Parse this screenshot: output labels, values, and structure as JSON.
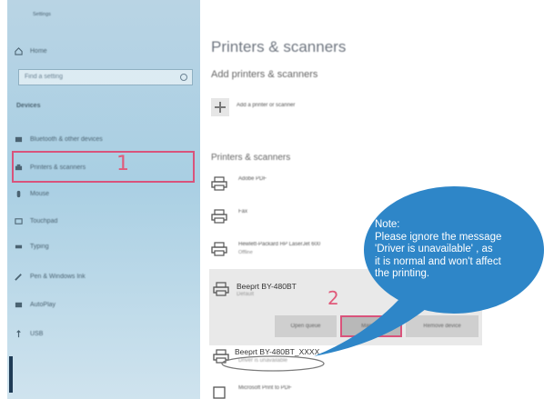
{
  "sidebar": {
    "title": "Settings",
    "home": "Home",
    "search_placeholder": "Find a setting",
    "section": "Devices",
    "items": [
      {
        "label": "Bluetooth & other devices",
        "icon": "bluetooth-icon"
      },
      {
        "label": "Printers & scanners",
        "icon": "printer-icon"
      },
      {
        "label": "Mouse",
        "icon": "mouse-icon"
      },
      {
        "label": "Touchpad",
        "icon": "touchpad-icon"
      },
      {
        "label": "Typing",
        "icon": "keyboard-icon"
      },
      {
        "label": "Pen & Windows Ink",
        "icon": "pen-icon"
      },
      {
        "label": "AutoPlay",
        "icon": "autoplay-icon"
      },
      {
        "label": "USB",
        "icon": "usb-icon"
      }
    ],
    "marker": "1"
  },
  "main": {
    "title": "Printers & scanners",
    "add_section": "Add printers & scanners",
    "add_label": "Add a printer or scanner",
    "list_section": "Printers & scanners",
    "printers": [
      {
        "name": "Adobe PDF",
        "sub": ""
      },
      {
        "name": "Fax",
        "sub": ""
      },
      {
        "name": "Hewlett-Packard HP LaserJet 600",
        "sub": "Offline"
      }
    ],
    "selected": {
      "name": "Beeprt BY-480BT",
      "sub": "Default",
      "buttons": [
        "Open queue",
        "Manage",
        "Remove device"
      ],
      "marker": "2"
    },
    "bottom_printer": {
      "name": "Beeprt BY-480BT_XXXX",
      "sub": "Driver is unavailable"
    },
    "last_printer": {
      "name": "Microsoft Print to PDF"
    }
  },
  "note": {
    "lines": [
      "Note:",
      "Please ignore the message",
      "'Driver is unavailable' , as",
      "it is normal and won't affect",
      "the printing."
    ]
  },
  "colors": {
    "sidebar_bg": "#b9d4e4",
    "highlight": "#d9537b",
    "callout": "#2e86c8"
  }
}
